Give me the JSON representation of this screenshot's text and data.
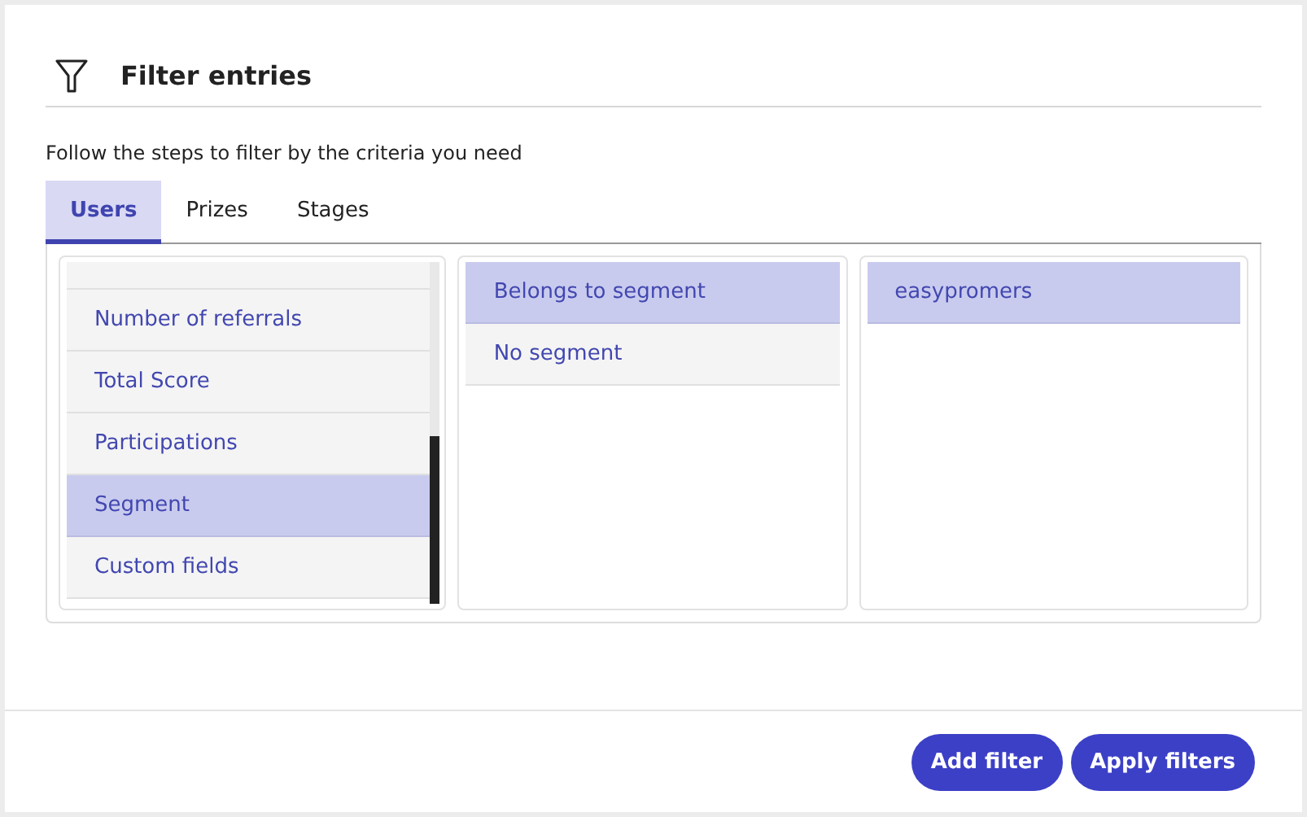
{
  "header": {
    "title": "Filter entries"
  },
  "instructions": "Follow the steps to filter by the criteria you need",
  "tabs": [
    {
      "label": "Users",
      "selected": true
    },
    {
      "label": "Prizes",
      "selected": false
    },
    {
      "label": "Stages",
      "selected": false
    }
  ],
  "lists": [
    {
      "items": [
        {
          "label": "Number of referrals",
          "selected": false
        },
        {
          "label": "Total Score",
          "selected": false
        },
        {
          "label": "Participations",
          "selected": false
        },
        {
          "label": "Segment",
          "selected": true
        },
        {
          "label": "Custom fields",
          "selected": false
        }
      ],
      "scrolled": true
    },
    {
      "items": [
        {
          "label": "Belongs to segment",
          "selected": true
        },
        {
          "label": "No segment",
          "selected": false
        }
      ],
      "scrolled": false
    },
    {
      "items": [
        {
          "label": "easypromers",
          "selected": true
        }
      ],
      "scrolled": false
    }
  ],
  "buttons": [
    "Add filter",
    "Apply filters"
  ]
}
